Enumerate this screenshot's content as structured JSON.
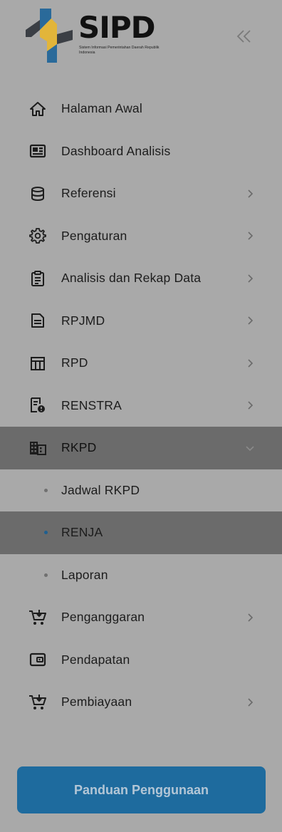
{
  "brand": {
    "title": "SIPD",
    "subtitle": "Sistem Informasi Pemerintahan Daerah Republik Indonesia",
    "colors": {
      "blue": "#2a6a9a",
      "yellow": "#e2b53a",
      "dark": "#3b3f45"
    }
  },
  "menu": [
    {
      "label": "Halaman Awal",
      "icon": "home-icon",
      "chevron": false
    },
    {
      "label": "Dashboard Analisis",
      "icon": "dashboard-icon",
      "chevron": false
    },
    {
      "label": "Referensi",
      "icon": "database-icon",
      "chevron": true
    },
    {
      "label": "Pengaturan",
      "icon": "gear-icon",
      "chevron": true
    },
    {
      "label": "Analisis dan Rekap Data",
      "icon": "clipboard-icon",
      "chevron": true
    },
    {
      "label": "RPJMD",
      "icon": "document-icon",
      "chevron": true
    },
    {
      "label": "RPD",
      "icon": "table-icon",
      "chevron": true
    },
    {
      "label": "RENSTRA",
      "icon": "report-icon",
      "chevron": true
    },
    {
      "label": "RKPD",
      "icon": "building-icon",
      "chevron": true,
      "expanded": true
    },
    {
      "label": "Jadwal RKPD",
      "sub": true
    },
    {
      "label": "RENJA",
      "sub": true,
      "selected": true
    },
    {
      "label": "Laporan",
      "sub": true
    },
    {
      "label": "Penganggaran",
      "icon": "cart-icon",
      "chevron": true
    },
    {
      "label": "Pendapatan",
      "icon": "wallet-icon",
      "chevron": false
    },
    {
      "label": "Pembiayaan",
      "icon": "cart-icon",
      "chevron": true
    }
  ],
  "guide_button": {
    "label": "Panduan Penggunaan",
    "color": "#1e6b9e"
  }
}
